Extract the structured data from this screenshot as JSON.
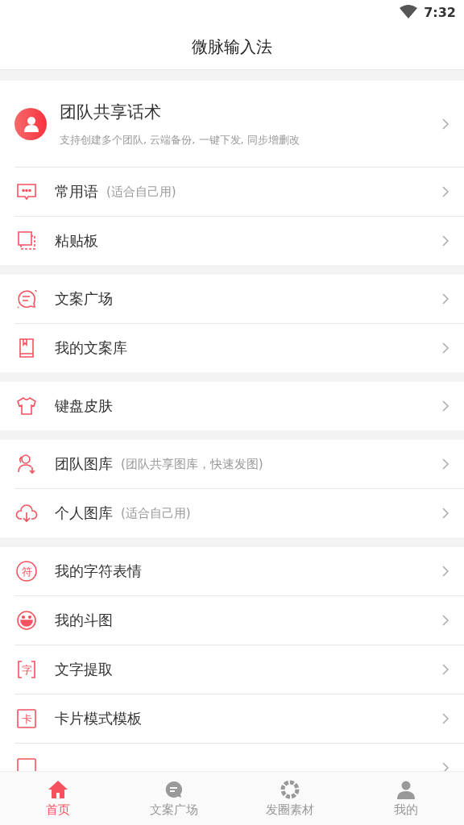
{
  "status_bar": {
    "time": "7:32"
  },
  "header": {
    "title": "微脉输入法"
  },
  "team_card": {
    "title": "团队共享话术",
    "subtitle": "支持创建多个团队, 云端备份, 一键下发, 同步增删改"
  },
  "groups": [
    [
      {
        "title": "常用语",
        "note": "(适合自己用)"
      },
      {
        "title": "粘贴板"
      }
    ],
    [
      {
        "title": "文案广场"
      },
      {
        "title": "我的文案库"
      }
    ],
    [
      {
        "title": "键盘皮肤"
      }
    ],
    [
      {
        "title": "团队图库",
        "note": "(团队共享图库，快速发图)"
      },
      {
        "title": "个人图库",
        "note": "(适合自己用)"
      }
    ],
    [
      {
        "title": "我的字符表情",
        "icon_text": "符"
      },
      {
        "title": "我的斗图"
      },
      {
        "title": "文字提取",
        "icon_text": "字"
      },
      {
        "title": "卡片模式模板",
        "icon_text": "卡"
      }
    ]
  ],
  "partial_row": true,
  "tabs": [
    {
      "label": "首页",
      "selected": true
    },
    {
      "label": "文案广场",
      "selected": false
    },
    {
      "label": "发圈素材",
      "selected": false
    },
    {
      "label": "我的",
      "selected": false
    }
  ]
}
